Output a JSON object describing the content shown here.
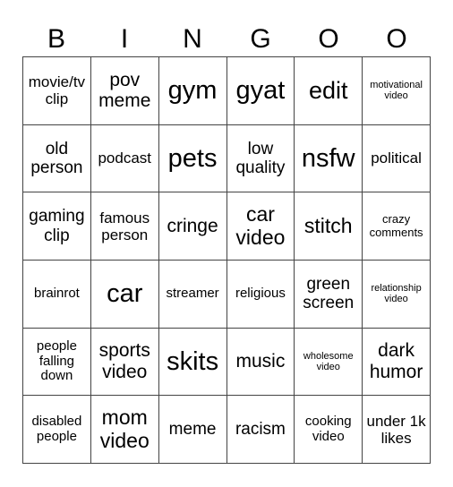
{
  "header": [
    "B",
    "I",
    "N",
    "G",
    "O",
    "O"
  ],
  "cells": [
    [
      "movie/tv clip",
      "pov meme",
      "gym",
      "gyat",
      "edit",
      "motivational video"
    ],
    [
      "old person",
      "podcast",
      "pets",
      "low quality",
      "nsfw",
      "political"
    ],
    [
      "gaming clip",
      "famous person",
      "cringe",
      "car video",
      "stitch",
      "crazy comments"
    ],
    [
      "brainrot",
      "car",
      "streamer",
      "religious",
      "green screen",
      "relationship video"
    ],
    [
      "people falling down",
      "sports video",
      "skits",
      "music",
      "wholesome video",
      "dark humor"
    ],
    [
      "disabled people",
      "mom video",
      "meme",
      "racism",
      "cooking video",
      "under 1k likes"
    ]
  ]
}
